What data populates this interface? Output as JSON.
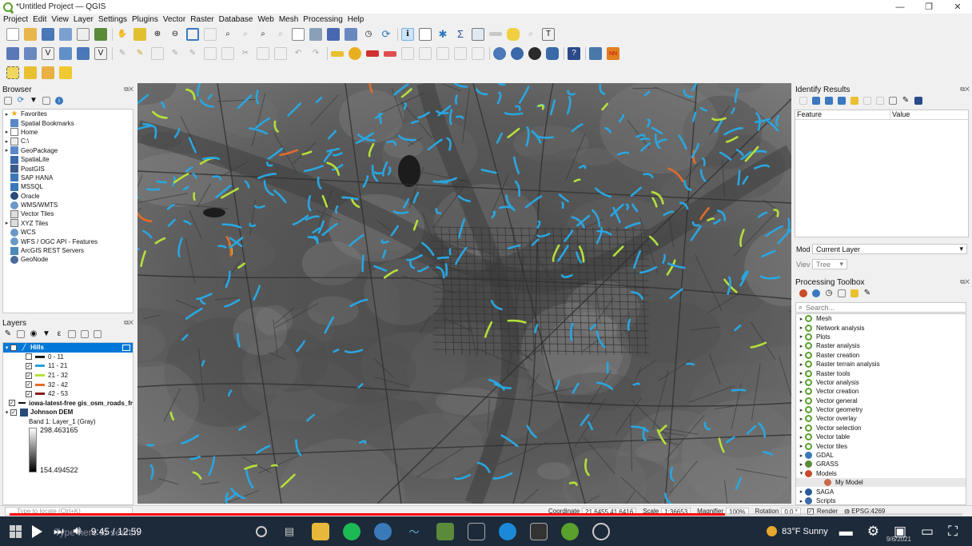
{
  "window": {
    "title": "*Untitled Project — QGIS",
    "controls": [
      "—",
      "❐",
      "✕"
    ]
  },
  "menu": [
    "Project",
    "Edit",
    "View",
    "Layer",
    "Settings",
    "Plugins",
    "Vector",
    "Raster",
    "Database",
    "Web",
    "Mesh",
    "Processing",
    "Help"
  ],
  "browser": {
    "title": "Browser",
    "items": [
      {
        "label": "Favorites",
        "icon": "star-icon",
        "expand": "▸"
      },
      {
        "label": "Spatial Bookmarks",
        "icon": "bookmark-icon",
        "expand": ""
      },
      {
        "label": "Home",
        "icon": "folder-icon",
        "expand": "▸"
      },
      {
        "label": "C:\\",
        "icon": "drive-icon",
        "expand": "▸"
      },
      {
        "label": "GeoPackage",
        "icon": "geopackage-icon",
        "expand": "▸"
      },
      {
        "label": "SpatiaLite",
        "icon": "spatialite-icon",
        "expand": ""
      },
      {
        "label": "PostGIS",
        "icon": "postgis-icon",
        "expand": ""
      },
      {
        "label": "SAP HANA",
        "icon": "database-icon",
        "expand": ""
      },
      {
        "label": "MSSQL",
        "icon": "database-icon",
        "expand": ""
      },
      {
        "label": "Oracle",
        "icon": "oracle-icon",
        "expand": ""
      },
      {
        "label": "WMS/WMTS",
        "icon": "globe-icon",
        "expand": ""
      },
      {
        "label": "Vector Tiles",
        "icon": "grid-icon",
        "expand": ""
      },
      {
        "label": "XYZ Tiles",
        "icon": "grid-icon",
        "expand": "▸"
      },
      {
        "label": "WCS",
        "icon": "globe-icon",
        "expand": ""
      },
      {
        "label": "WFS / OGC API - Features",
        "icon": "globe-icon",
        "expand": ""
      },
      {
        "label": "ArcGIS REST Servers",
        "icon": "server-icon",
        "expand": ""
      },
      {
        "label": "GeoNode",
        "icon": "geonode-icon",
        "expand": ""
      }
    ]
  },
  "layers": {
    "title": "Layers",
    "rows": [
      {
        "type": "layer",
        "label": "Hills",
        "selected": true,
        "checked": true
      },
      {
        "type": "class",
        "label": "0 - 11",
        "color": "#1a1a1a",
        "checked": false
      },
      {
        "type": "class",
        "label": "11 - 21",
        "color": "#2a9fd8",
        "checked": true
      },
      {
        "type": "class",
        "label": "21 - 32",
        "color": "#b6e03a",
        "checked": true
      },
      {
        "type": "class",
        "label": "32 - 42",
        "color": "#e36c2a",
        "checked": true
      },
      {
        "type": "class",
        "label": "42 - 53",
        "color": "#8b1a1a",
        "checked": true
      },
      {
        "type": "layer",
        "label": "iowa-latest-free gis_osm_roads_fr",
        "selected": false,
        "checked": true
      },
      {
        "type": "layer",
        "label": "Johnson DEM",
        "selected": false,
        "checked": true
      }
    ],
    "band": "Band 1: Layer_1 (Gray)",
    "ramp_max": "298.463165",
    "ramp_min": "154.494522"
  },
  "identify": {
    "title": "Identify Results",
    "col_feature": "Feature",
    "col_value": "Value",
    "mode_label": "Mod",
    "mode_value": "Current Layer",
    "view_label": "Viev",
    "view_value": "Tree"
  },
  "processing": {
    "title": "Processing Toolbox",
    "search_placeholder": "Search...",
    "items": [
      {
        "label": "Mesh",
        "icon": "q-icon",
        "indent": 0
      },
      {
        "label": "Network analysis",
        "icon": "q-icon",
        "indent": 0
      },
      {
        "label": "Plots",
        "icon": "q-icon",
        "indent": 0
      },
      {
        "label": "Raster analysis",
        "icon": "q-icon",
        "indent": 0
      },
      {
        "label": "Raster creation",
        "icon": "q-icon",
        "indent": 0
      },
      {
        "label": "Raster terrain analysis",
        "icon": "q-icon",
        "indent": 0
      },
      {
        "label": "Raster tools",
        "icon": "q-icon",
        "indent": 0
      },
      {
        "label": "Vector analysis",
        "icon": "q-icon",
        "indent": 0
      },
      {
        "label": "Vector creation",
        "icon": "q-icon",
        "indent": 0
      },
      {
        "label": "Vector general",
        "icon": "q-icon",
        "indent": 0
      },
      {
        "label": "Vector geometry",
        "icon": "q-icon",
        "indent": 0
      },
      {
        "label": "Vector overlay",
        "icon": "q-icon",
        "indent": 0
      },
      {
        "label": "Vector selection",
        "icon": "q-icon",
        "indent": 0
      },
      {
        "label": "Vector table",
        "icon": "q-icon",
        "indent": 0
      },
      {
        "label": "Vector tiles",
        "icon": "q-icon",
        "indent": 0
      },
      {
        "label": "GDAL",
        "icon": "gdal-icon",
        "indent": 0
      },
      {
        "label": "GRASS",
        "icon": "grass-icon",
        "indent": 0
      },
      {
        "label": "Models",
        "icon": "models-icon",
        "indent": 0
      },
      {
        "label": "My Model",
        "icon": "model-icon",
        "indent": 1
      },
      {
        "label": "SAGA",
        "icon": "saga-icon",
        "indent": 0
      },
      {
        "label": "Scripts",
        "icon": "scripts-icon",
        "indent": 0
      }
    ]
  },
  "status": {
    "locate_placeholder": "Type to locate (Ctrl+K)",
    "coordinate_label": "Coordinate",
    "coordinate_value": "21.6455,41.6416",
    "scale_label": "Scale",
    "scale_value": "1:36653",
    "magnifier_label": "Magnifier",
    "magnifier_value": "100%",
    "rotation_label": "Rotation",
    "rotation_value": "0.0 °",
    "render_label": "Render",
    "crs": "EPSG:4269"
  },
  "video": {
    "time": "9:45 / 12:59",
    "progress": 0.751,
    "search_ghost": "Type here to search",
    "weather": "83°F  Sunny",
    "date": "9/6/2021"
  },
  "colors": {
    "road_blue": "#2aa6e0",
    "road_green": "#b6e03a",
    "road_orange": "#e36c2a",
    "selected_layer": "#0078d7"
  }
}
